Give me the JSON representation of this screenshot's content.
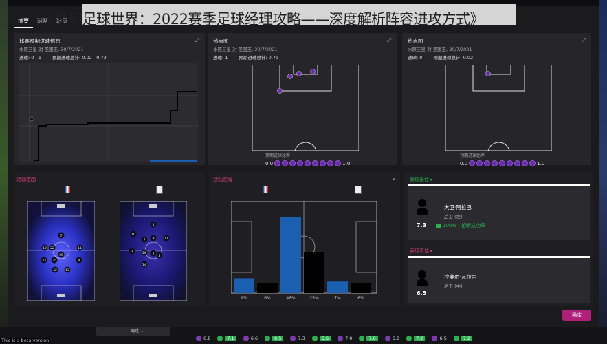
{
  "overlay_title": "《梦幻足球世界：2022赛季足球经理攻略——深度解析阵容进攻方式》",
  "tabs": [
    "摘要",
    "球队",
    "球员"
  ],
  "xg_panel": {
    "title": "比赛预期进球信息",
    "subtitle": "水原三星 对 圣国王, 30/7/2021",
    "goals": "进球: 0 - 1",
    "xg": "预期进球总计: 0.02 - 0.79"
  },
  "shot_left": {
    "title": "热点图",
    "subtitle": "水原三星 对 圣国王, 30/7/2021",
    "goals": "进球: 1",
    "xg": "预期进球总计: 0.79",
    "scale_label": "预期进球比率",
    "scale_min": "0.0",
    "scale_max": "1.0"
  },
  "shot_right": {
    "title": "热点图",
    "subtitle": "水原三星 对 圣国王, 30/7/2021",
    "goals": "进球: 0",
    "xg": "预期进球总计: 0.02",
    "scale_label": "预期进球比率",
    "scale_min": "0.0",
    "scale_max": "1.0"
  },
  "activity": {
    "title": "活动范围"
  },
  "zones": {
    "title": "活动区域",
    "bars": [
      {
        "label": "9%",
        "value": 9,
        "color": "#1a5fb0"
      },
      {
        "label": "6%",
        "value": 6,
        "color": "#000000"
      },
      {
        "label": "46%",
        "value": 46,
        "color": "#1a5fb0"
      },
      {
        "label": "25%",
        "value": 25,
        "color": "#000000"
      },
      {
        "label": "7%",
        "value": 7,
        "color": "#1a5fb0"
      },
      {
        "label": "6%",
        "value": 6,
        "color": "#000000"
      }
    ]
  },
  "best": {
    "title": "表现最佳 ▸",
    "name": "大卫·阿拉巴",
    "position": "后卫 (左)",
    "rating": "7.3",
    "stat": "100% - 抢断成功率"
  },
  "worst": {
    "title": "表现不佳 ▸",
    "name": "拉斐尔·瓦拉内",
    "position": "后卫 (中)",
    "rating": "6.5",
    "stat": "-"
  },
  "confirm": "确定",
  "beta": "This is a beta version",
  "bottom_ratings": [
    "6.8",
    "7.1",
    "6.6",
    "6.5",
    "7.3",
    "6.6",
    "7.0",
    "7.0",
    "6.8",
    "7.2",
    "6.5",
    "7.2"
  ],
  "bottom_label": "略过",
  "home_numbers": [
    "7",
    "10",
    "22",
    "11",
    "25",
    "33",
    "35",
    "4",
    "42",
    "13"
  ],
  "away_numbers": [
    "5",
    "10",
    "7",
    "9",
    "11",
    "3",
    "28",
    "2",
    "4",
    "14"
  ],
  "colors": {
    "accent": "#b0207a",
    "purple": "#6a2ab0",
    "blue": "#1a5fb0",
    "green": "#2ab050",
    "red": "#d04070"
  }
}
